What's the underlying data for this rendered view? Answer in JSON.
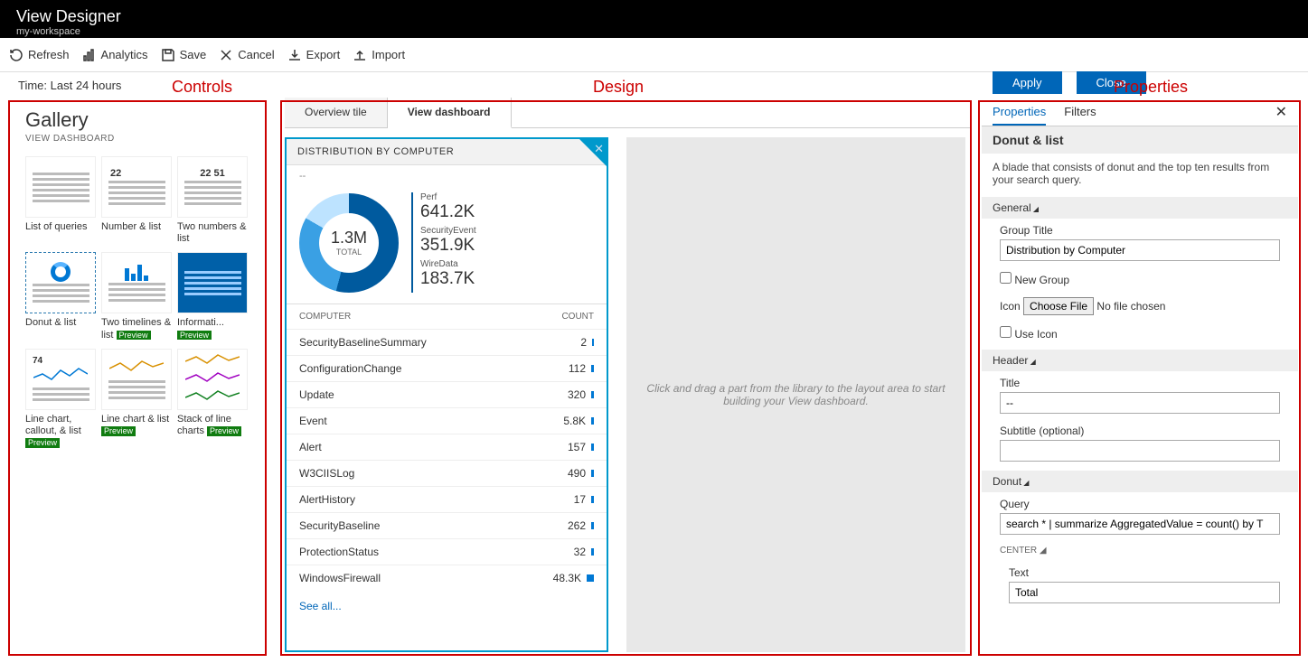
{
  "header": {
    "title": "View Designer",
    "subtitle": "my-workspace"
  },
  "toolbar": {
    "refresh": "Refresh",
    "analytics": "Analytics",
    "save": "Save",
    "cancel": "Cancel",
    "export": "Export",
    "import": "Import"
  },
  "time_label": "Time: Last 24 hours",
  "annotations": {
    "controls": "Controls",
    "design": "Design",
    "properties": "Properties"
  },
  "gallery": {
    "title": "Gallery",
    "subtitle": "VIEW DASHBOARD",
    "items": [
      {
        "label": "List of queries",
        "preview": false
      },
      {
        "label": "Number & list",
        "preview": false,
        "num": "22"
      },
      {
        "label": "Two numbers & list",
        "preview": false,
        "nums": "22  51"
      },
      {
        "label": "Donut & list",
        "preview": false,
        "selected": true
      },
      {
        "label": "Two timelines & list",
        "preview": true
      },
      {
        "label": "Informati...",
        "preview": true
      },
      {
        "label": "Line chart, callout, & list",
        "preview": true,
        "num": "74"
      },
      {
        "label": "Line chart & list",
        "preview": true
      },
      {
        "label": "Stack of line charts",
        "preview": true
      }
    ]
  },
  "design": {
    "tabs": [
      {
        "label": "Overview tile",
        "active": false
      },
      {
        "label": "View dashboard",
        "active": true
      }
    ],
    "tile": {
      "title": "DISTRIBUTION BY COMPUTER",
      "subtitle": "--",
      "center_value": "1.3M",
      "center_label": "TOTAL",
      "legend": [
        {
          "name": "Perf",
          "value": "641.2K"
        },
        {
          "name": "SecurityEvent",
          "value": "351.9K"
        },
        {
          "name": "WireData",
          "value": "183.7K"
        }
      ],
      "columns": {
        "left": "COMPUTER",
        "right": "COUNT"
      },
      "rows": [
        {
          "name": "SecurityBaselineSummary",
          "count": "2",
          "w": 2
        },
        {
          "name": "ConfigurationChange",
          "count": "112",
          "w": 3
        },
        {
          "name": "Update",
          "count": "320",
          "w": 3
        },
        {
          "name": "Event",
          "count": "5.8K",
          "w": 3
        },
        {
          "name": "Alert",
          "count": "157",
          "w": 3
        },
        {
          "name": "W3CIISLog",
          "count": "490",
          "w": 3
        },
        {
          "name": "AlertHistory",
          "count": "17",
          "w": 3
        },
        {
          "name": "SecurityBaseline",
          "count": "262",
          "w": 3
        },
        {
          "name": "ProtectionStatus",
          "count": "32",
          "w": 3
        },
        {
          "name": "WindowsFirewall",
          "count": "48.3K",
          "w": 8
        }
      ],
      "see_all": "See all..."
    },
    "drop_hint": "Click and drag a part from the library to the layout area to start building your View dashboard."
  },
  "props": {
    "tabs": {
      "properties": "Properties",
      "filters": "Filters"
    },
    "title": "Donut & list",
    "desc": "A blade that consists of donut and the top ten results from your search query.",
    "general": {
      "section": "General",
      "group_title_label": "Group Title",
      "group_title_value": "Distribution by Computer",
      "new_group": "New Group",
      "icon_label": "Icon",
      "choose_file": "Choose File",
      "no_file": "No file chosen",
      "use_icon": "Use Icon"
    },
    "header": {
      "section": "Header",
      "title_label": "Title",
      "title_value": "--",
      "subtitle_label": "Subtitle (optional)",
      "subtitle_value": ""
    },
    "donut": {
      "section": "Donut",
      "query_label": "Query",
      "query_value": "search * | summarize AggregatedValue = count() by T",
      "center_section": "CENTER",
      "text_label": "Text",
      "text_value": "Total"
    },
    "buttons": {
      "apply": "Apply",
      "close": "Close"
    }
  }
}
